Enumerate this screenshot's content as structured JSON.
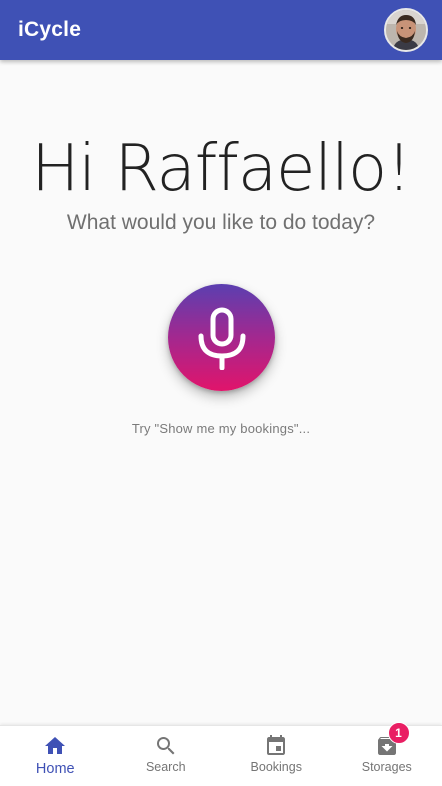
{
  "app": {
    "title": "iCycle"
  },
  "main": {
    "greeting": "Hi Raffaello!",
    "subtitle": "What would you like to do today?",
    "hint": "Try \"Show me my bookings\"..."
  },
  "bottom_nav": {
    "items": [
      {
        "label": "Home",
        "icon": "home-icon",
        "active": true
      },
      {
        "label": "Search",
        "icon": "search-icon",
        "active": false
      },
      {
        "label": "Bookings",
        "icon": "calendar-icon",
        "active": false
      },
      {
        "label": "Storages",
        "icon": "archive-icon",
        "active": false,
        "badge": "1"
      }
    ]
  },
  "colors": {
    "primary": "#3f51b5",
    "accent": "#e91e63",
    "mic_gradient_top": "#5b3fb0",
    "mic_gradient_bottom": "#e1146b"
  }
}
